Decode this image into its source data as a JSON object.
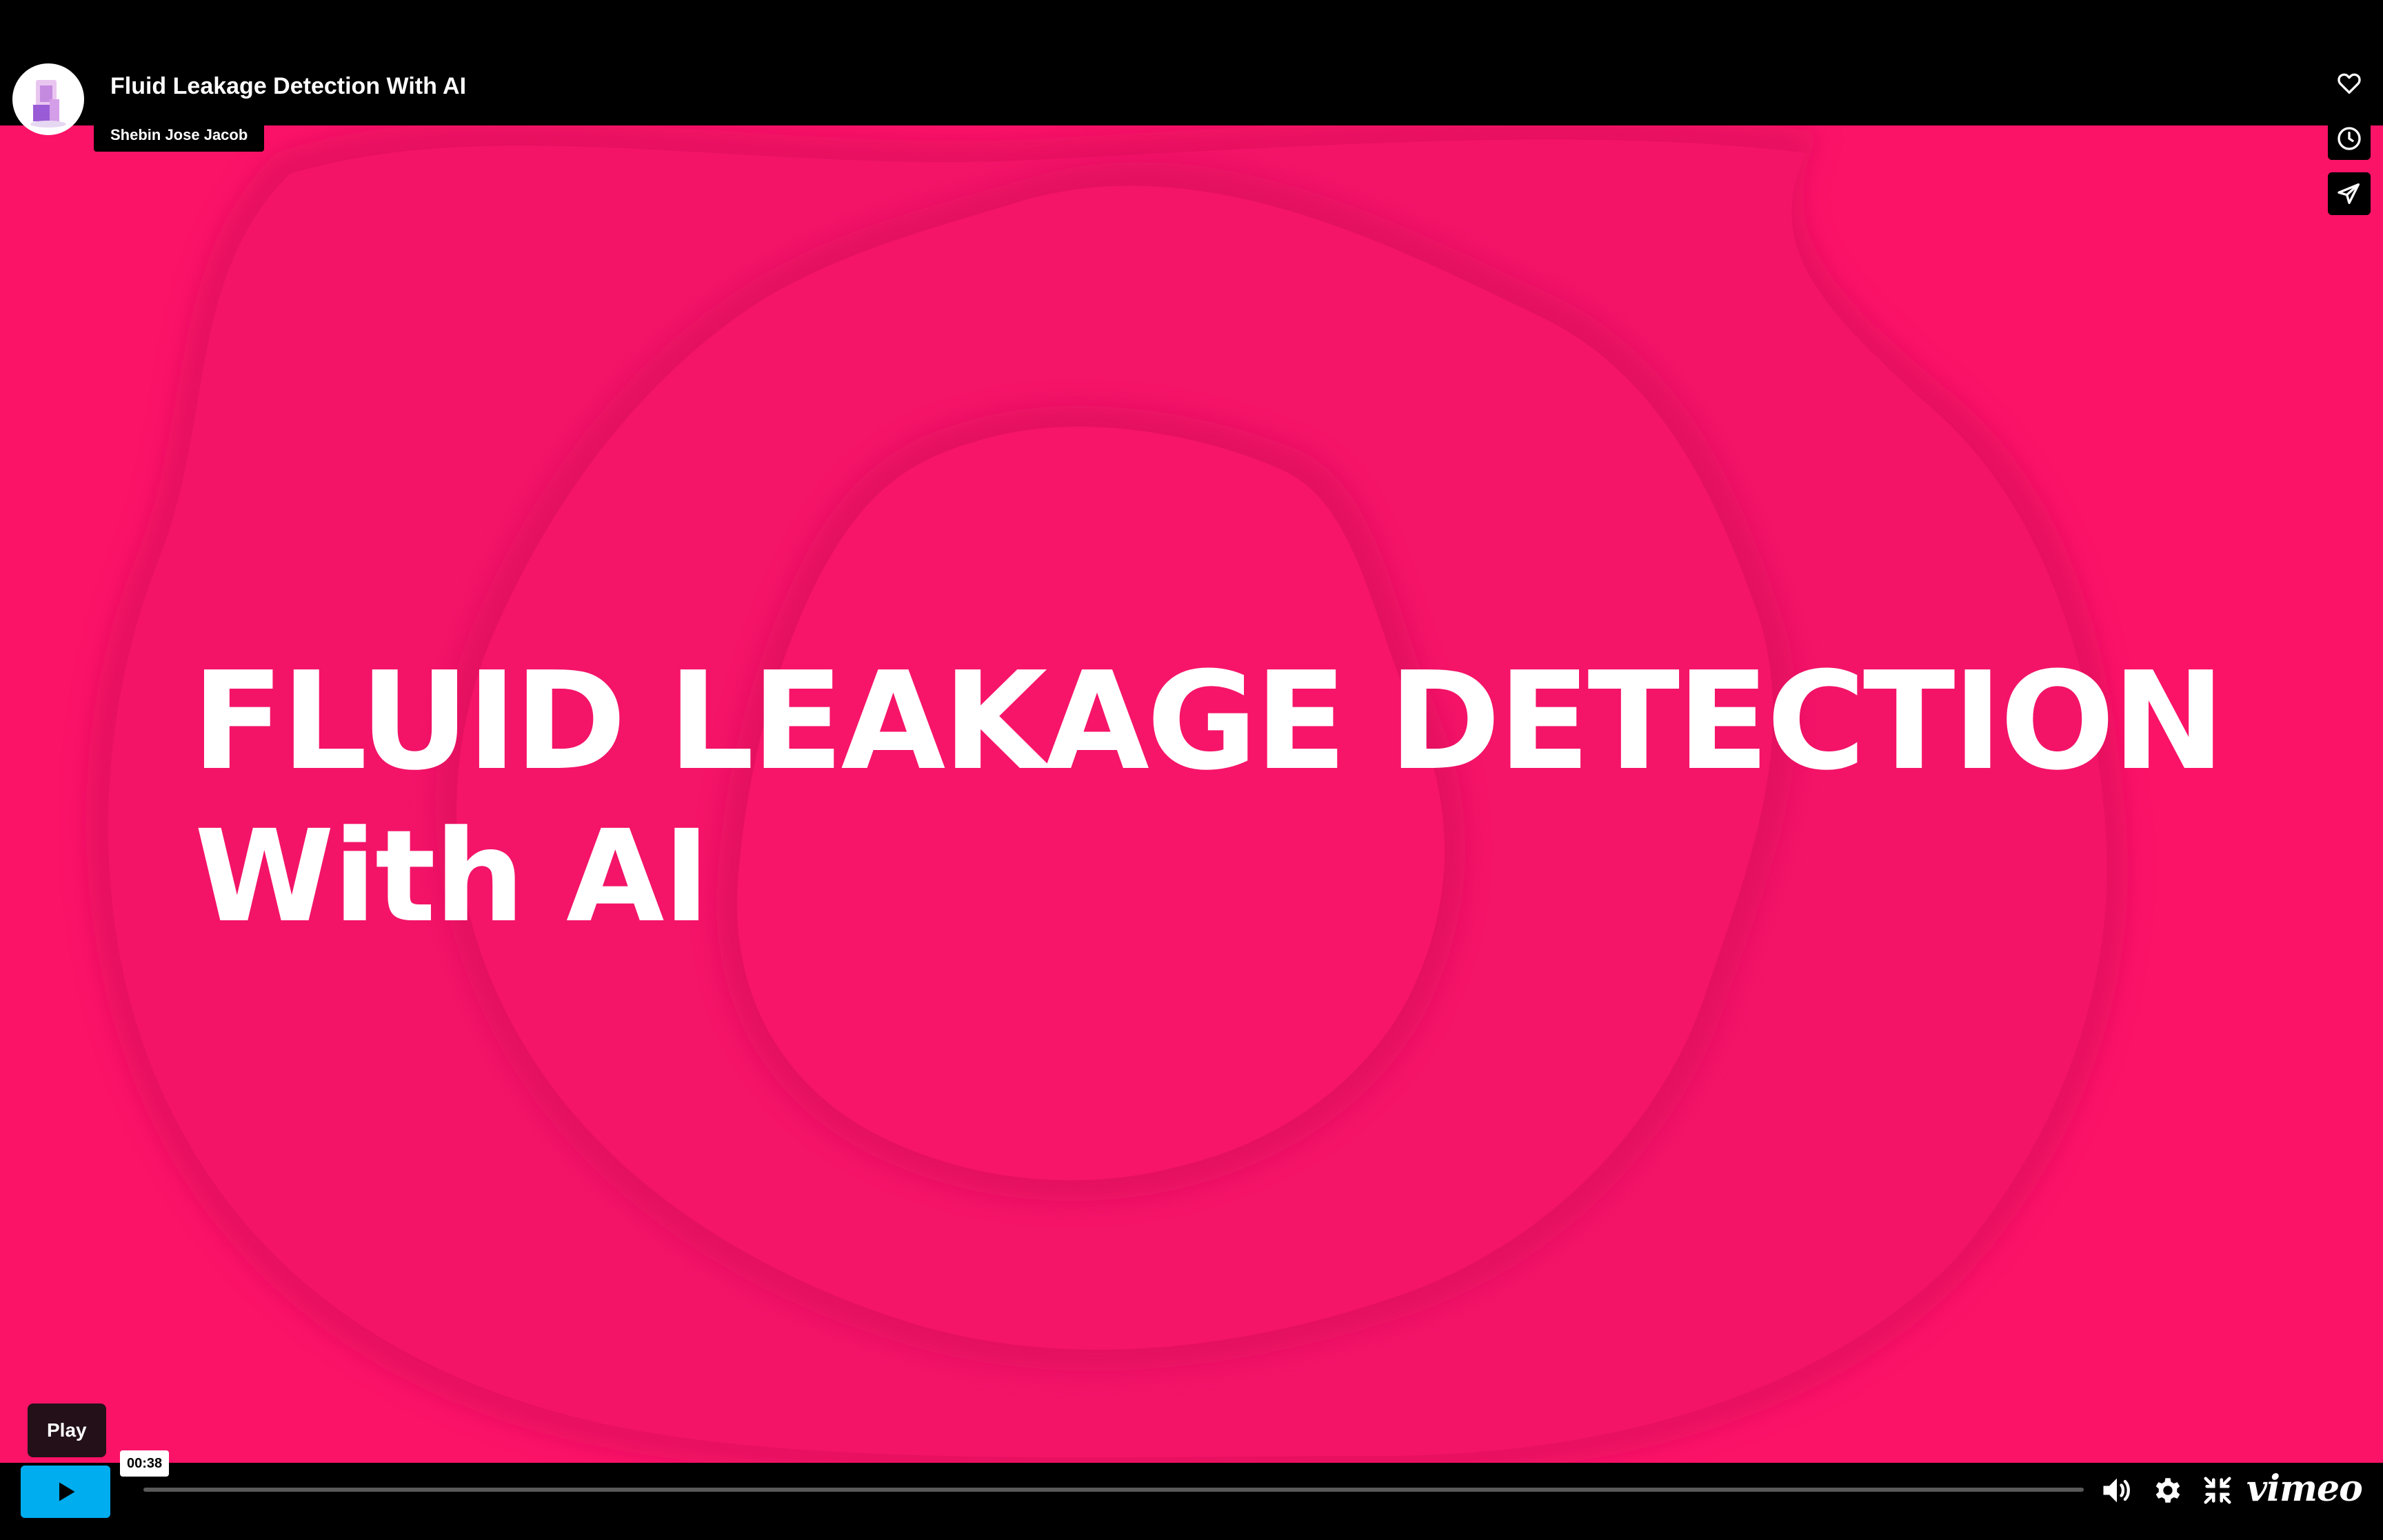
{
  "video": {
    "title": "Fluid Leakage Detection With AI",
    "author": "Shebin Jose Jacob",
    "slide_heading": "FLUID LEAKAGE DETECTION",
    "slide_subheading": "With AI",
    "background_color": "#fb1368"
  },
  "actions": {
    "like_icon": "heart-icon",
    "watch_later_icon": "clock-icon",
    "share_icon": "paper-plane-icon"
  },
  "controls": {
    "play_tooltip": "Play",
    "play_icon": "play-icon",
    "current_time": "00:38",
    "progress_fraction": 0.0,
    "volume_icon": "volume-icon",
    "settings_icon": "gear-icon",
    "fullscreen_icon": "fullscreen-exit-icon",
    "brand": "vimeo",
    "accent_color": "#00adef"
  }
}
